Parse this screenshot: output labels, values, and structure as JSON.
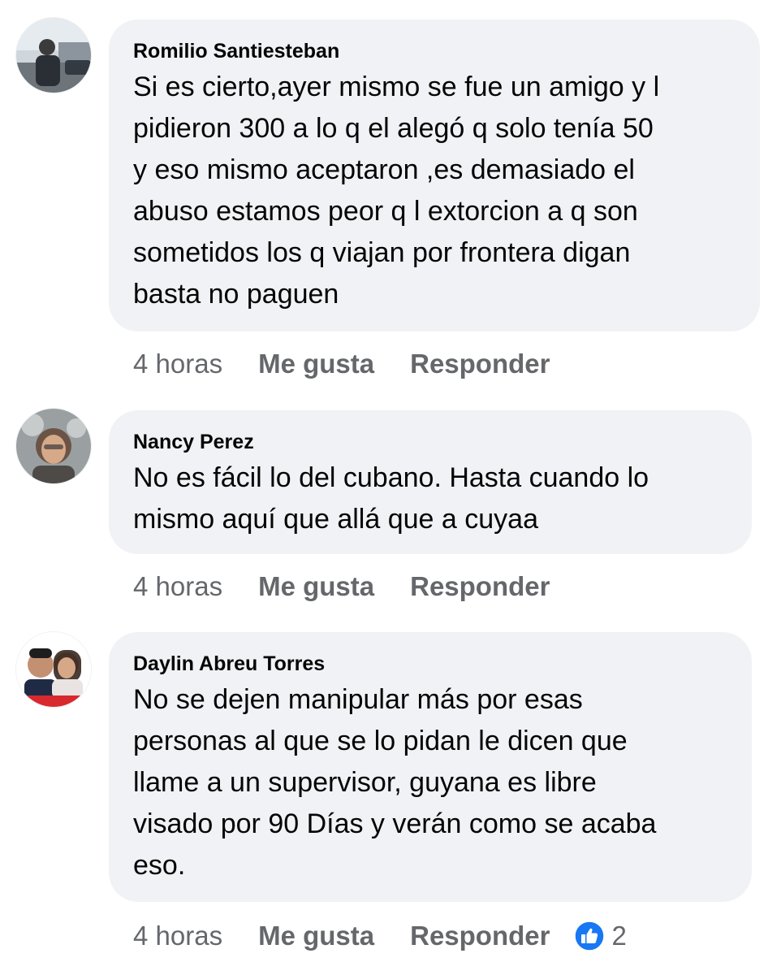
{
  "comments": [
    {
      "author": "Romilio Santiesteban",
      "text": "Si es cierto,ayer mismo se fue un amigo y l\npidieron 300 a lo q el alegó q solo tenía 50\ny eso mismo aceptaron ,es demasiado el\nabuso estamos peor q l extorcion a q son\nsometidos los q viajan por frontera digan\nbasta no paguen",
      "time": "4 horas",
      "like_label": "Me gusta",
      "reply_label": "Responder"
    },
    {
      "author": "Nancy Perez",
      "text": "No es fácil lo del cubano. Hasta cuando lo\nmismo aquí que allá que a cuyaa",
      "time": "4 horas",
      "like_label": "Me gusta",
      "reply_label": "Responder"
    },
    {
      "author": "Daylin Abreu Torres",
      "text": "No se dejen manipular más por esas\npersonas al que se lo pidan le dicen que\nllame a un supervisor, guyana es libre\nvisado por 90 Días y verán como se acaba\neso.",
      "time": "4 horas",
      "like_label": "Me gusta",
      "reply_label": "Responder",
      "reaction_icon": "like-icon",
      "reaction_count": "2"
    }
  ],
  "colors": {
    "bubble_bg": "#f0f2f5",
    "meta_text": "#65676b",
    "like_blue": "#1877f2"
  }
}
